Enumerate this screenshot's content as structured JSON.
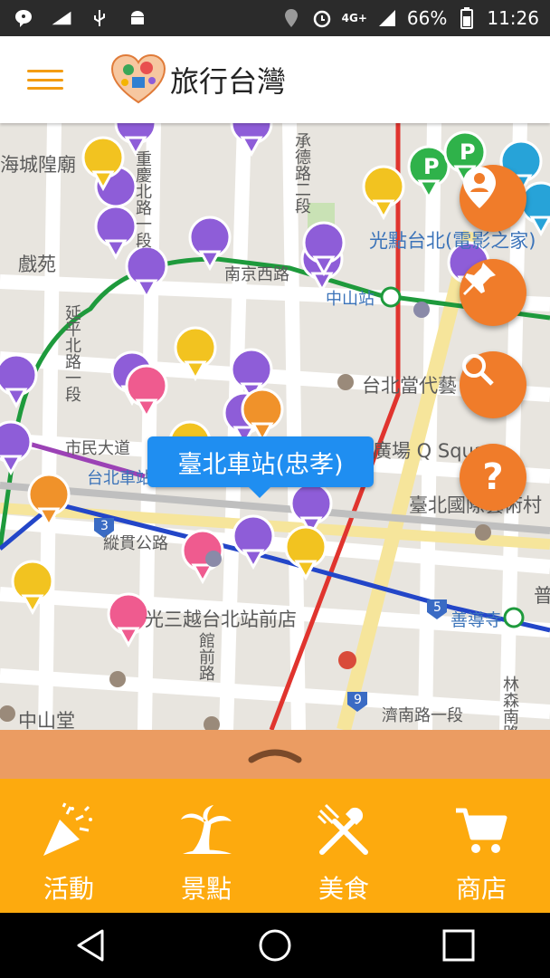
{
  "status_bar": {
    "icons": [
      "message-icon",
      "signal-chart-icon",
      "usb-icon",
      "android-icon",
      "location-icon",
      "alarm-icon",
      "lte-icon",
      "cell-signal-icon",
      "battery-icon"
    ],
    "network": "4G+",
    "battery": "66%",
    "time": "11:26"
  },
  "app_bar": {
    "menu_icon": "hamburger-menu-icon",
    "title": "旅行台灣"
  },
  "map": {
    "labels": {
      "l1": "海城隍廟",
      "l2": "戲苑",
      "l3": "重慶北路一段",
      "l4": "承德路二段",
      "l5": "南京西路",
      "l6": "中山站",
      "l7": "光點台北(電影之家)",
      "l8": "延平北路一段",
      "l9": "台北當代藝",
      "l10": "市民大道",
      "l11": "台北車站",
      "l12": "廣場 Q Square",
      "l13": "臺北國際藝術村",
      "l14": "縱貫公路",
      "l15": "光三越台北站前店",
      "l16": "館前路",
      "l17": "善導寺",
      "l18": "中山堂",
      "l19": "濟南路一段",
      "l20": "林森南路",
      "l21": "普"
    },
    "route_numbers": [
      "3",
      "5",
      "9"
    ],
    "callout": "臺北車站(忠孝)"
  },
  "fab": {
    "user_location": "user-location-icon",
    "pin": "pin-icon",
    "search": "search-icon",
    "help": "help-icon",
    "help_text": "?"
  },
  "bottom_nav": {
    "items": [
      {
        "label": "活動",
        "icon": "party-popper-icon"
      },
      {
        "label": "景點",
        "icon": "palm-tree-icon"
      },
      {
        "label": "美食",
        "icon": "fork-knife-icon"
      },
      {
        "label": "商店",
        "icon": "shopping-cart-icon"
      }
    ]
  },
  "colors": {
    "accent": "#fdaa0e",
    "fab": "#f07c2a",
    "drawer": "#eb9c62",
    "callout": "#1f8ef1",
    "bus_pin": "#8e5dd8",
    "food_pin": "#f2c320",
    "shop_pin": "#ef5b8f",
    "parking_pin": "#2fb24a",
    "hotel_pin": "#27a3d8"
  }
}
